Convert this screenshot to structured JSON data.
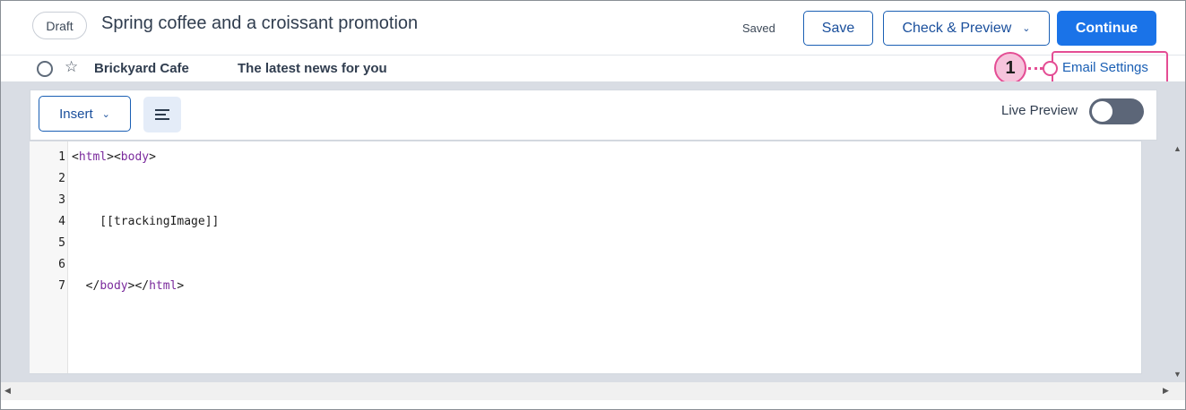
{
  "header": {
    "status": "Draft",
    "title": "Spring coffee and a croissant promotion",
    "saved_label": "Saved",
    "save_label": "Save",
    "check_preview_label": "Check & Preview",
    "continue_label": "Continue"
  },
  "subbar": {
    "sender": "Brickyard Cafe",
    "subject": "The latest news for you",
    "email_settings_label": "Email Settings",
    "callout_number": "1"
  },
  "toolbar": {
    "insert_label": "Insert",
    "live_preview_label": "Live Preview",
    "live_preview_on": false
  },
  "code": {
    "line_numbers": [
      "1",
      "2",
      "3",
      "4",
      "5",
      "6",
      "7"
    ],
    "line1_open": "<",
    "line1_tag1": "html",
    "line1_mid": "><",
    "line1_tag2": "body",
    "line1_close": ">",
    "line4": "    [[trackingImage]]",
    "line7_open": "  </",
    "line7_tag1": "body",
    "line7_mid": "></",
    "line7_tag2": "html",
    "line7_close": ">"
  },
  "icons": {
    "check_chevron": "chevron-down-icon",
    "insert_chevron": "chevron-down-icon",
    "align": "align-left-icon",
    "star": "star-icon"
  },
  "colors": {
    "primary": "#1a73e8",
    "accent_callout": "#e44d94",
    "toggle_off": "#5c6678"
  }
}
